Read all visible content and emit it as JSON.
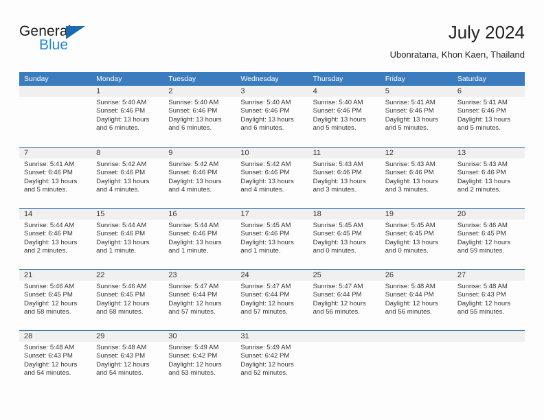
{
  "logo": {
    "word_one": "General",
    "word_two": "Blue",
    "triangle_color": "#1b6ab0",
    "blue_text_color": "#2288dd"
  },
  "header": {
    "title": "July 2024",
    "subtitle": "Ubonratana, Khon Kaen, Thailand"
  },
  "theme": {
    "header_row_bg": "#3a7cbe",
    "header_row_text": "#ffffff",
    "date_band_bg": "#f0f0f0",
    "row_divider": "#2e6da8",
    "page_bg": "#fdfdfd",
    "body_text": "#333333"
  },
  "calendar": {
    "day_headers": [
      "Sunday",
      "Monday",
      "Tuesday",
      "Wednesday",
      "Thursday",
      "Friday",
      "Saturday"
    ],
    "weeks": [
      [
        {
          "date": "",
          "sunrise": "",
          "sunset": "",
          "daylight": "",
          "empty": true
        },
        {
          "date": "1",
          "sunrise": "Sunrise: 5:40 AM",
          "sunset": "Sunset: 6:46 PM",
          "daylight": "Daylight: 13 hours and 6 minutes."
        },
        {
          "date": "2",
          "sunrise": "Sunrise: 5:40 AM",
          "sunset": "Sunset: 6:46 PM",
          "daylight": "Daylight: 13 hours and 6 minutes."
        },
        {
          "date": "3",
          "sunrise": "Sunrise: 5:40 AM",
          "sunset": "Sunset: 6:46 PM",
          "daylight": "Daylight: 13 hours and 6 minutes."
        },
        {
          "date": "4",
          "sunrise": "Sunrise: 5:40 AM",
          "sunset": "Sunset: 6:46 PM",
          "daylight": "Daylight: 13 hours and 5 minutes."
        },
        {
          "date": "5",
          "sunrise": "Sunrise: 5:41 AM",
          "sunset": "Sunset: 6:46 PM",
          "daylight": "Daylight: 13 hours and 5 minutes."
        },
        {
          "date": "6",
          "sunrise": "Sunrise: 5:41 AM",
          "sunset": "Sunset: 6:46 PM",
          "daylight": "Daylight: 13 hours and 5 minutes."
        }
      ],
      [
        {
          "date": "7",
          "sunrise": "Sunrise: 5:41 AM",
          "sunset": "Sunset: 6:46 PM",
          "daylight": "Daylight: 13 hours and 5 minutes."
        },
        {
          "date": "8",
          "sunrise": "Sunrise: 5:42 AM",
          "sunset": "Sunset: 6:46 PM",
          "daylight": "Daylight: 13 hours and 4 minutes."
        },
        {
          "date": "9",
          "sunrise": "Sunrise: 5:42 AM",
          "sunset": "Sunset: 6:46 PM",
          "daylight": "Daylight: 13 hours and 4 minutes."
        },
        {
          "date": "10",
          "sunrise": "Sunrise: 5:42 AM",
          "sunset": "Sunset: 6:46 PM",
          "daylight": "Daylight: 13 hours and 4 minutes."
        },
        {
          "date": "11",
          "sunrise": "Sunrise: 5:43 AM",
          "sunset": "Sunset: 6:46 PM",
          "daylight": "Daylight: 13 hours and 3 minutes."
        },
        {
          "date": "12",
          "sunrise": "Sunrise: 5:43 AM",
          "sunset": "Sunset: 6:46 PM",
          "daylight": "Daylight: 13 hours and 3 minutes."
        },
        {
          "date": "13",
          "sunrise": "Sunrise: 5:43 AM",
          "sunset": "Sunset: 6:46 PM",
          "daylight": "Daylight: 13 hours and 2 minutes."
        }
      ],
      [
        {
          "date": "14",
          "sunrise": "Sunrise: 5:44 AM",
          "sunset": "Sunset: 6:46 PM",
          "daylight": "Daylight: 13 hours and 2 minutes."
        },
        {
          "date": "15",
          "sunrise": "Sunrise: 5:44 AM",
          "sunset": "Sunset: 6:46 PM",
          "daylight": "Daylight: 13 hours and 1 minute."
        },
        {
          "date": "16",
          "sunrise": "Sunrise: 5:44 AM",
          "sunset": "Sunset: 6:46 PM",
          "daylight": "Daylight: 13 hours and 1 minute."
        },
        {
          "date": "17",
          "sunrise": "Sunrise: 5:45 AM",
          "sunset": "Sunset: 6:46 PM",
          "daylight": "Daylight: 13 hours and 1 minute."
        },
        {
          "date": "18",
          "sunrise": "Sunrise: 5:45 AM",
          "sunset": "Sunset: 6:45 PM",
          "daylight": "Daylight: 13 hours and 0 minutes."
        },
        {
          "date": "19",
          "sunrise": "Sunrise: 5:45 AM",
          "sunset": "Sunset: 6:45 PM",
          "daylight": "Daylight: 13 hours and 0 minutes."
        },
        {
          "date": "20",
          "sunrise": "Sunrise: 5:46 AM",
          "sunset": "Sunset: 6:45 PM",
          "daylight": "Daylight: 12 hours and 59 minutes."
        }
      ],
      [
        {
          "date": "21",
          "sunrise": "Sunrise: 5:46 AM",
          "sunset": "Sunset: 6:45 PM",
          "daylight": "Daylight: 12 hours and 58 minutes."
        },
        {
          "date": "22",
          "sunrise": "Sunrise: 5:46 AM",
          "sunset": "Sunset: 6:45 PM",
          "daylight": "Daylight: 12 hours and 58 minutes."
        },
        {
          "date": "23",
          "sunrise": "Sunrise: 5:47 AM",
          "sunset": "Sunset: 6:44 PM",
          "daylight": "Daylight: 12 hours and 57 minutes."
        },
        {
          "date": "24",
          "sunrise": "Sunrise: 5:47 AM",
          "sunset": "Sunset: 6:44 PM",
          "daylight": "Daylight: 12 hours and 57 minutes."
        },
        {
          "date": "25",
          "sunrise": "Sunrise: 5:47 AM",
          "sunset": "Sunset: 6:44 PM",
          "daylight": "Daylight: 12 hours and 56 minutes."
        },
        {
          "date": "26",
          "sunrise": "Sunrise: 5:48 AM",
          "sunset": "Sunset: 6:44 PM",
          "daylight": "Daylight: 12 hours and 56 minutes."
        },
        {
          "date": "27",
          "sunrise": "Sunrise: 5:48 AM",
          "sunset": "Sunset: 6:43 PM",
          "daylight": "Daylight: 12 hours and 55 minutes."
        }
      ],
      [
        {
          "date": "28",
          "sunrise": "Sunrise: 5:48 AM",
          "sunset": "Sunset: 6:43 PM",
          "daylight": "Daylight: 12 hours and 54 minutes."
        },
        {
          "date": "29",
          "sunrise": "Sunrise: 5:48 AM",
          "sunset": "Sunset: 6:43 PM",
          "daylight": "Daylight: 12 hours and 54 minutes."
        },
        {
          "date": "30",
          "sunrise": "Sunrise: 5:49 AM",
          "sunset": "Sunset: 6:42 PM",
          "daylight": "Daylight: 12 hours and 53 minutes."
        },
        {
          "date": "31",
          "sunrise": "Sunrise: 5:49 AM",
          "sunset": "Sunset: 6:42 PM",
          "daylight": "Daylight: 12 hours and 52 minutes."
        },
        {
          "date": "",
          "sunrise": "",
          "sunset": "",
          "daylight": "",
          "empty": true
        },
        {
          "date": "",
          "sunrise": "",
          "sunset": "",
          "daylight": "",
          "empty": true
        },
        {
          "date": "",
          "sunrise": "",
          "sunset": "",
          "daylight": "",
          "empty": true
        }
      ]
    ]
  }
}
